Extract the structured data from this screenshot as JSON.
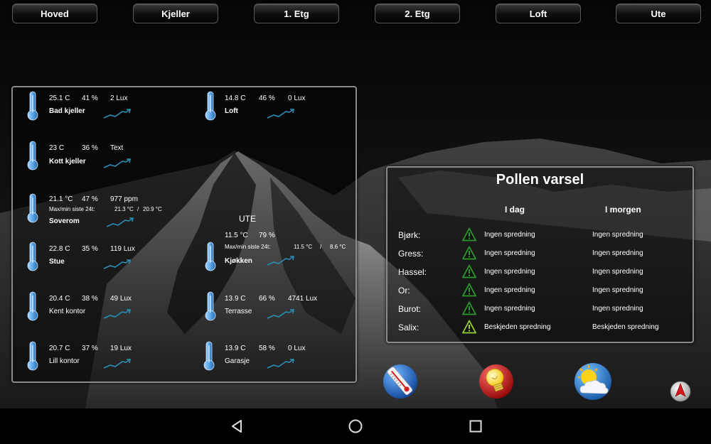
{
  "nav": {
    "tabs": [
      "Hoved",
      "Kjeller",
      "1. Etg",
      "2. Etg",
      "Loft",
      "Ute"
    ]
  },
  "sensors": {
    "bad_kjeller": {
      "temp": "25.1 C",
      "hum": "41 %",
      "extra": "2 Lux",
      "name": "Bad kjeller"
    },
    "loft": {
      "temp": "14.8 C",
      "hum": "46 %",
      "extra": "0 Lux",
      "name": "Loft"
    },
    "kott_kjeller": {
      "temp": "23 C",
      "hum": "36 %",
      "extra": "Text",
      "name": "Kott kjeller"
    },
    "soverom": {
      "temp": "21.1 °C",
      "hum": "47 %",
      "extra": "977 ppm",
      "name": "Soverom",
      "minmax_label": "Max/min siste 24t:",
      "max": "21.3 °C",
      "sep": "/",
      "min": "20.9 °C"
    },
    "ute": {
      "title": "UTE",
      "temp": "11.5 °C",
      "hum": "79 %",
      "minmax_label": "Max/min siste 24t:",
      "max": "11.5 °C",
      "sep": "/",
      "min": "8.6 °C"
    },
    "stue": {
      "temp": "22.8 C",
      "hum": "35 %",
      "extra": "119 Lux",
      "name": "Stue"
    },
    "kjokken": {
      "name": "Kjøkken"
    },
    "kent_kontor": {
      "temp": "20.4 C",
      "hum": "38 %",
      "extra": "49 Lux",
      "name": "Kent kontor"
    },
    "terrasse": {
      "temp": "13.9 C",
      "hum": "66 %",
      "extra": "4741 Lux",
      "name": "Terrasse"
    },
    "lill_kontor": {
      "temp": "20.7 C",
      "hum": "37 %",
      "extra": "19 Lux",
      "name": "Lill kontor"
    },
    "garasje": {
      "temp": "13.9 C",
      "hum": "58 %",
      "extra": "0 Lux",
      "name": "Garasje"
    }
  },
  "pollen": {
    "title": "Pollen varsel",
    "col_today": "I dag",
    "col_tomorrow": "I morgen",
    "rows": [
      {
        "plant": "Bjørk:",
        "today": "Ingen spredning",
        "tomorrow": "Ingen spredning",
        "level": "none"
      },
      {
        "plant": "Gress:",
        "today": "Ingen spredning",
        "tomorrow": "Ingen spredning",
        "level": "none"
      },
      {
        "plant": "Hassel:",
        "today": "Ingen spredning",
        "tomorrow": "Ingen spredning",
        "level": "none"
      },
      {
        "plant": "Or:",
        "today": "Ingen spredning",
        "tomorrow": "Ingen spredning",
        "level": "none"
      },
      {
        "plant": "Burot:",
        "today": "Ingen spredning",
        "tomorrow": "Ingen spredning",
        "level": "none"
      },
      {
        "plant": "Salix:",
        "today": "Beskjeden spredning",
        "tomorrow": "Beskjeden spredning",
        "level": "low"
      }
    ]
  },
  "icons": {
    "thermometer": "thermometer-icon",
    "trend": "trend-up-icon",
    "warning": "warning-icon",
    "shortcuts": [
      "thermometer-shortcut-icon",
      "lightbulb-icon",
      "weather-icon",
      "compass-icon"
    ]
  },
  "colors": {
    "accent_trend": "#2a8fb5",
    "warn_none": "#2a9a2a",
    "warn_low": "#9ad02a",
    "therm_blue": "#5aa6e6",
    "nav_icons": "#dcdcdc"
  }
}
